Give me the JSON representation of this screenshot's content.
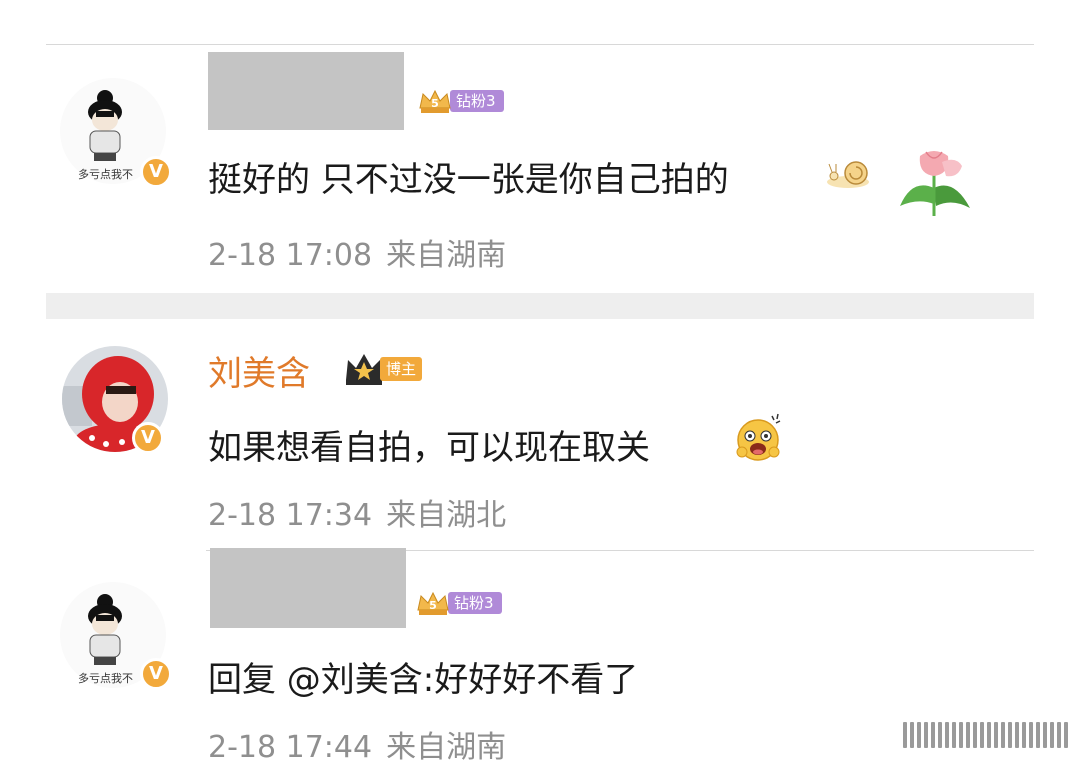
{
  "comments": [
    {
      "username": "",
      "badge": "钻粉3",
      "text": "挺好的 只不过没一张是你自己拍的",
      "time": "2-18 17:08",
      "location": "来自湖南",
      "avatar_caption": "多亏点我不"
    },
    {
      "username": "刘美含",
      "badge": "博主",
      "text": "如果想看自拍，可以现在取关",
      "time": "2-18 17:34",
      "location": "来自湖北"
    },
    {
      "username": "",
      "badge": "钻粉3",
      "text": "回复 @刘美含:好好好不看了",
      "time": "2-18 17:44",
      "location": "来自湖南",
      "avatar_caption": "多亏点我不"
    }
  ],
  "verified_mark": "V",
  "colors": {
    "username": "#e07a2a",
    "fan_badge": "#b08ad8",
    "owner_badge": "#f2a93b",
    "meta_text": "#8f8f8f"
  },
  "icons": [
    "crown-s-icon",
    "crown-icon",
    "snail-emoji",
    "tulip-emoji",
    "laugh-emoji",
    "verified-icon"
  ]
}
